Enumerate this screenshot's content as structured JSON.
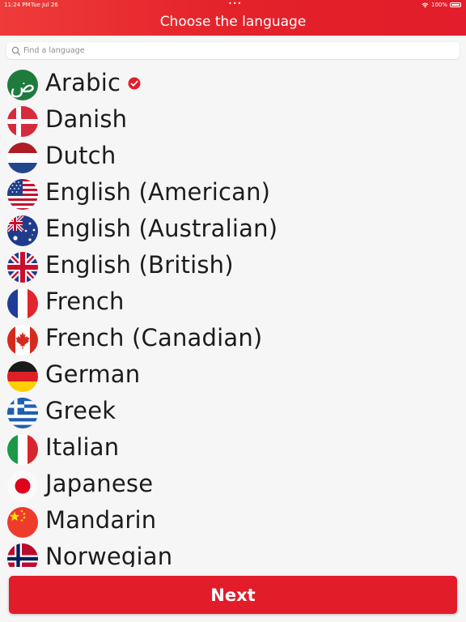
{
  "status_bar": {
    "time": "11:24 PM",
    "date": "Tue Jul 26",
    "dots": "•••",
    "battery": "100%"
  },
  "header": {
    "title": "Choose the language",
    "background": "#e5222b"
  },
  "search": {
    "placeholder": "Find a language",
    "value": ""
  },
  "languages": [
    {
      "name": "Arabic",
      "flag": "arabic-flag-icon",
      "selected": true
    },
    {
      "name": "Danish",
      "flag": "denmark-flag-icon",
      "selected": false
    },
    {
      "name": "Dutch",
      "flag": "netherlands-flag-icon",
      "selected": false
    },
    {
      "name": "English (American)",
      "flag": "usa-flag-icon",
      "selected": false
    },
    {
      "name": "English (Australian)",
      "flag": "australia-flag-icon",
      "selected": false
    },
    {
      "name": "English (British)",
      "flag": "uk-flag-icon",
      "selected": false
    },
    {
      "name": "French",
      "flag": "france-flag-icon",
      "selected": false
    },
    {
      "name": "French (Canadian)",
      "flag": "canada-flag-icon",
      "selected": false
    },
    {
      "name": "German",
      "flag": "germany-flag-icon",
      "selected": false
    },
    {
      "name": "Greek",
      "flag": "greece-flag-icon",
      "selected": false
    },
    {
      "name": "Italian",
      "flag": "italy-flag-icon",
      "selected": false
    },
    {
      "name": "Japanese",
      "flag": "japan-flag-icon",
      "selected": false
    },
    {
      "name": "Mandarin",
      "flag": "china-flag-icon",
      "selected": false
    },
    {
      "name": "Norwegian",
      "flag": "norway-flag-icon",
      "selected": false
    }
  ],
  "arabic_glyph": "ض",
  "next_button": {
    "label": "Next",
    "color": "#e31c2a"
  },
  "accent_color": "#e31c2a"
}
